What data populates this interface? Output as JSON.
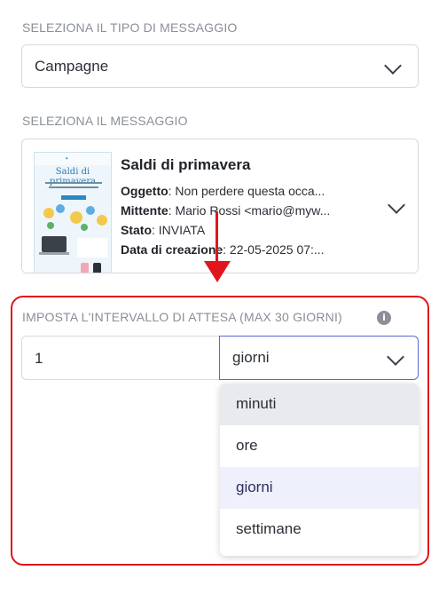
{
  "message_type": {
    "label": "SELEZIONA IL TIPO DI MESSAGGIO",
    "selected": "Campagne"
  },
  "message": {
    "label": "SELEZIONA IL MESSAGGIO",
    "thumbnail_title": "Saldi di primavera",
    "title": "Saldi di primavera",
    "subject_key": "Oggetto",
    "subject_value": ": Non perdere questa occa...",
    "sender_key": "Mittente",
    "sender_value": ": Mario Rossi <mario@myw...",
    "status_key": "Stato",
    "status_value": ": INVIATA",
    "created_key": "Data di creazione",
    "created_value": ": 22-05-2025 07:..."
  },
  "interval": {
    "label": "IMPOSTA L'INTERVALLO DI ATTESA (MAX 30 GIORNI)",
    "info_icon": "info-icon",
    "value": "1",
    "unit_selected": "giorni",
    "options": [
      "minuti",
      "ore",
      "giorni",
      "settimane"
    ],
    "hovered_option": "minuti"
  },
  "colors": {
    "highlight": "#e0161c",
    "focus_border": "#5b67d4",
    "hover_bg": "#e9eaed",
    "selected_bg": "#eef0fb"
  }
}
